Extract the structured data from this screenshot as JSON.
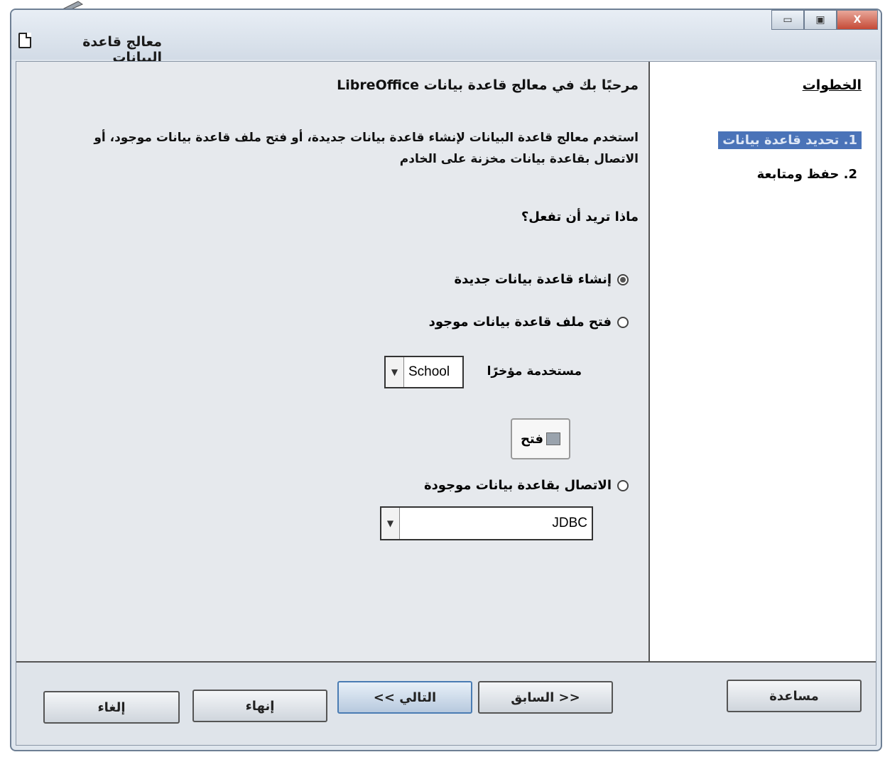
{
  "window": {
    "title": "معالج قاعدة البيانات",
    "controls": {
      "minimize": "▭",
      "maximize": "▣",
      "close": "X"
    }
  },
  "steps": {
    "title": "الخطوات",
    "items": [
      {
        "label": "1. تحديد قاعدة بيانات",
        "active": true
      },
      {
        "label": "2. حفظ ومتابعة",
        "active": false
      }
    ]
  },
  "main": {
    "heading": "مرحبًا بك في معالج قاعدة بيانات LibreOffice",
    "description": "استخدم معالج قاعدة البيانات لإنشاء قاعدة بيانات جديدة، أو فتح ملف قاعدة بيانات موجود، أو الاتصال بقاعدة بيانات مخزنة على الخادم",
    "question": "ماذا تريد أن تفعل؟",
    "options": {
      "create_new": "إنشاء قاعدة بيانات جديدة",
      "open_existing": "فتح ملف قاعدة بيانات موجود",
      "connect_existing": "الاتصال بقاعدة بيانات موجودة"
    },
    "recently_used_label": "مستخدمة مؤخرًا",
    "recent_db_value": "School",
    "open_button": "فتح",
    "connection_type_value": "JDBC"
  },
  "footer": {
    "help": "مساعدة",
    "back": "<< السابق",
    "next": "التالي >>",
    "finish": "إنهاء",
    "cancel": "إلغاء"
  }
}
